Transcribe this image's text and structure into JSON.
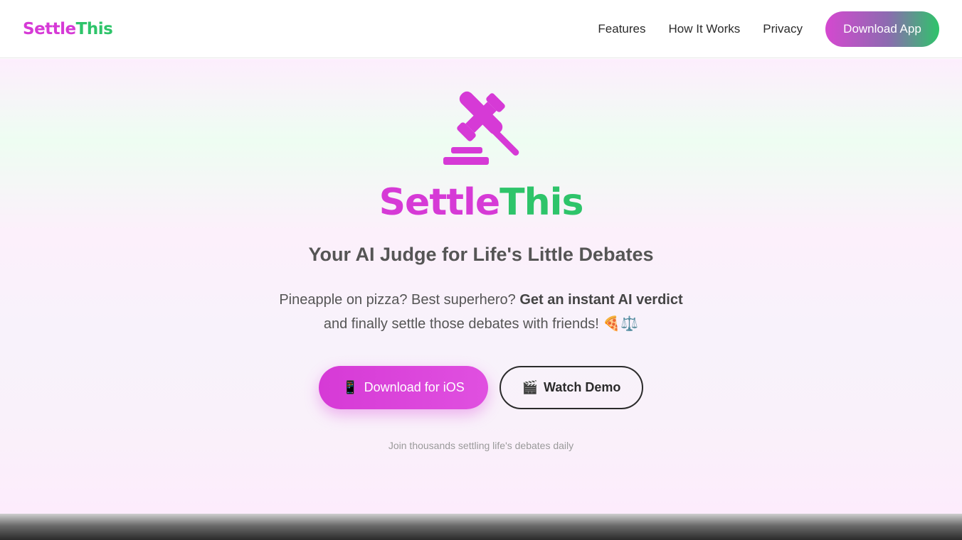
{
  "nav": {
    "logo_part1": "Settle",
    "logo_part2": "This",
    "links": [
      "Features",
      "How It Works",
      "Privacy"
    ],
    "cta": "Download App"
  },
  "hero": {
    "icon": "gavel-icon",
    "title_part1": "Settle",
    "title_part2": "This",
    "tagline": "Your AI Judge for Life's Little Debates",
    "desc_line1_a": "Pineapple on pizza? Best superhero? ",
    "desc_line1_b": "Get an instant AI verdict",
    "desc_line2": "and finally settle those debates with friends! 🍕⚖️",
    "btn_ios": "Download for iOS",
    "btn_ios_icon": "📱",
    "btn_demo": "Watch Demo",
    "btn_demo_icon": "🎬",
    "social_proof": "Join thousands settling life's debates daily"
  },
  "colors": {
    "brand_pink": "#d63ad6",
    "brand_green": "#2ec46a"
  }
}
